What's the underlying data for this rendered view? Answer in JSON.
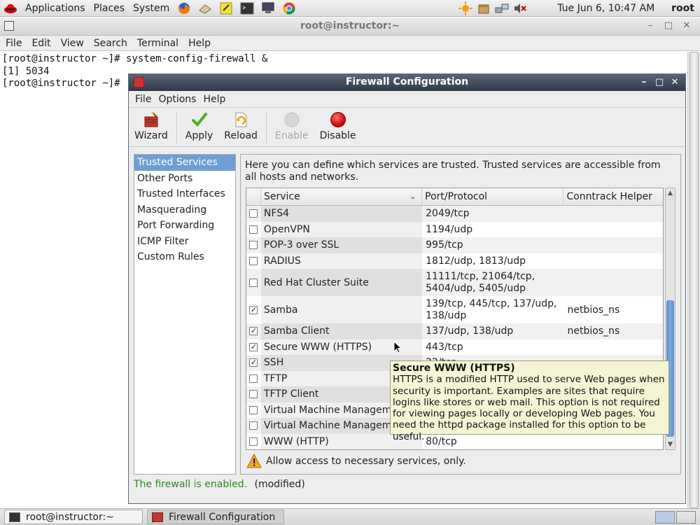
{
  "top_panel": {
    "menus": [
      "Applications",
      "Places",
      "System"
    ],
    "launchers": [
      "firefox-icon",
      "notes-icon",
      "sticky-note-icon",
      "terminal-icon",
      "computer-icon",
      "chrome-icon"
    ],
    "clock": "Tue Jun  6, 10:47 AM",
    "user": "root"
  },
  "terminal": {
    "title": "root@instructor:~",
    "menu": [
      "File",
      "Edit",
      "View",
      "Search",
      "Terminal",
      "Help"
    ],
    "lines": [
      "[root@instructor ~]# system-config-firewall &",
      "[1] 5034",
      "[root@instructor ~]#"
    ]
  },
  "firewall": {
    "title": "Firewall Configuration",
    "menu": [
      "File",
      "Options",
      "Help"
    ],
    "toolbar": {
      "wizard": "Wizard",
      "apply": "Apply",
      "reload": "Reload",
      "enable": "Enable",
      "disable": "Disable"
    },
    "nav": [
      "Trusted Services",
      "Other Ports",
      "Trusted Interfaces",
      "Masquerading",
      "Port Forwarding",
      "ICMP Filter",
      "Custom Rules"
    ],
    "nav_selected": "Trusted Services",
    "description": "Here you can define which services are trusted. Trusted services are accessible from all hosts and networks.",
    "columns": {
      "service": "Service",
      "port": "Port/Protocol",
      "helper": "Conntrack Helper"
    },
    "rows": [
      {
        "checked": false,
        "service": "NFS4",
        "port": "2049/tcp",
        "helper": ""
      },
      {
        "checked": false,
        "service": "OpenVPN",
        "port": "1194/udp",
        "helper": ""
      },
      {
        "checked": false,
        "service": "POP-3 over SSL",
        "port": "995/tcp",
        "helper": ""
      },
      {
        "checked": false,
        "service": "RADIUS",
        "port": "1812/udp, 1813/udp",
        "helper": ""
      },
      {
        "checked": false,
        "service": "Red Hat Cluster Suite",
        "port": "11111/tcp, 21064/tcp, 5404/udp, 5405/udp",
        "helper": ""
      },
      {
        "checked": true,
        "service": "Samba",
        "port": "139/tcp, 445/tcp, 137/udp, 138/udp",
        "helper": "netbios_ns"
      },
      {
        "checked": true,
        "service": "Samba Client",
        "port": "137/udp, 138/udp",
        "helper": "netbios_ns"
      },
      {
        "checked": true,
        "service": "Secure WWW (HTTPS)",
        "port": "443/tcp",
        "helper": ""
      },
      {
        "checked": true,
        "service": "SSH",
        "port": "22/tcp",
        "helper": ""
      },
      {
        "checked": false,
        "service": "TFTP",
        "port": "",
        "helper": ""
      },
      {
        "checked": false,
        "service": "TFTP Client",
        "port": "",
        "helper": ""
      },
      {
        "checked": false,
        "service": "Virtual Machine Managemen",
        "port": "",
        "helper": ""
      },
      {
        "checked": false,
        "service": "Virtual Machine Managemen",
        "port": "",
        "helper": ""
      },
      {
        "checked": false,
        "service": "WWW (HTTP)",
        "port": "80/tcp",
        "helper": ""
      }
    ],
    "warning": "Allow access to necessary services, only.",
    "status_enabled": "The firewall is enabled.",
    "status_modified": "(modified)",
    "tooltip": {
      "title": "Secure WWW (HTTPS)",
      "body": "HTTPS is a modified HTTP used to serve Web pages when security is important. Examples are sites that require logins like stores or web mail. This option is not required for viewing pages locally or developing Web pages. You need the httpd package installed for this option to be useful."
    }
  },
  "taskbar": {
    "tasks": [
      "root@instructor:~",
      "Firewall Configuration"
    ]
  },
  "colors": {
    "accent": "#6e9ed3",
    "status_ok": "#2e8b22",
    "titlebar": "#3b4556",
    "tooltip_bg": "#f5f5d4"
  }
}
